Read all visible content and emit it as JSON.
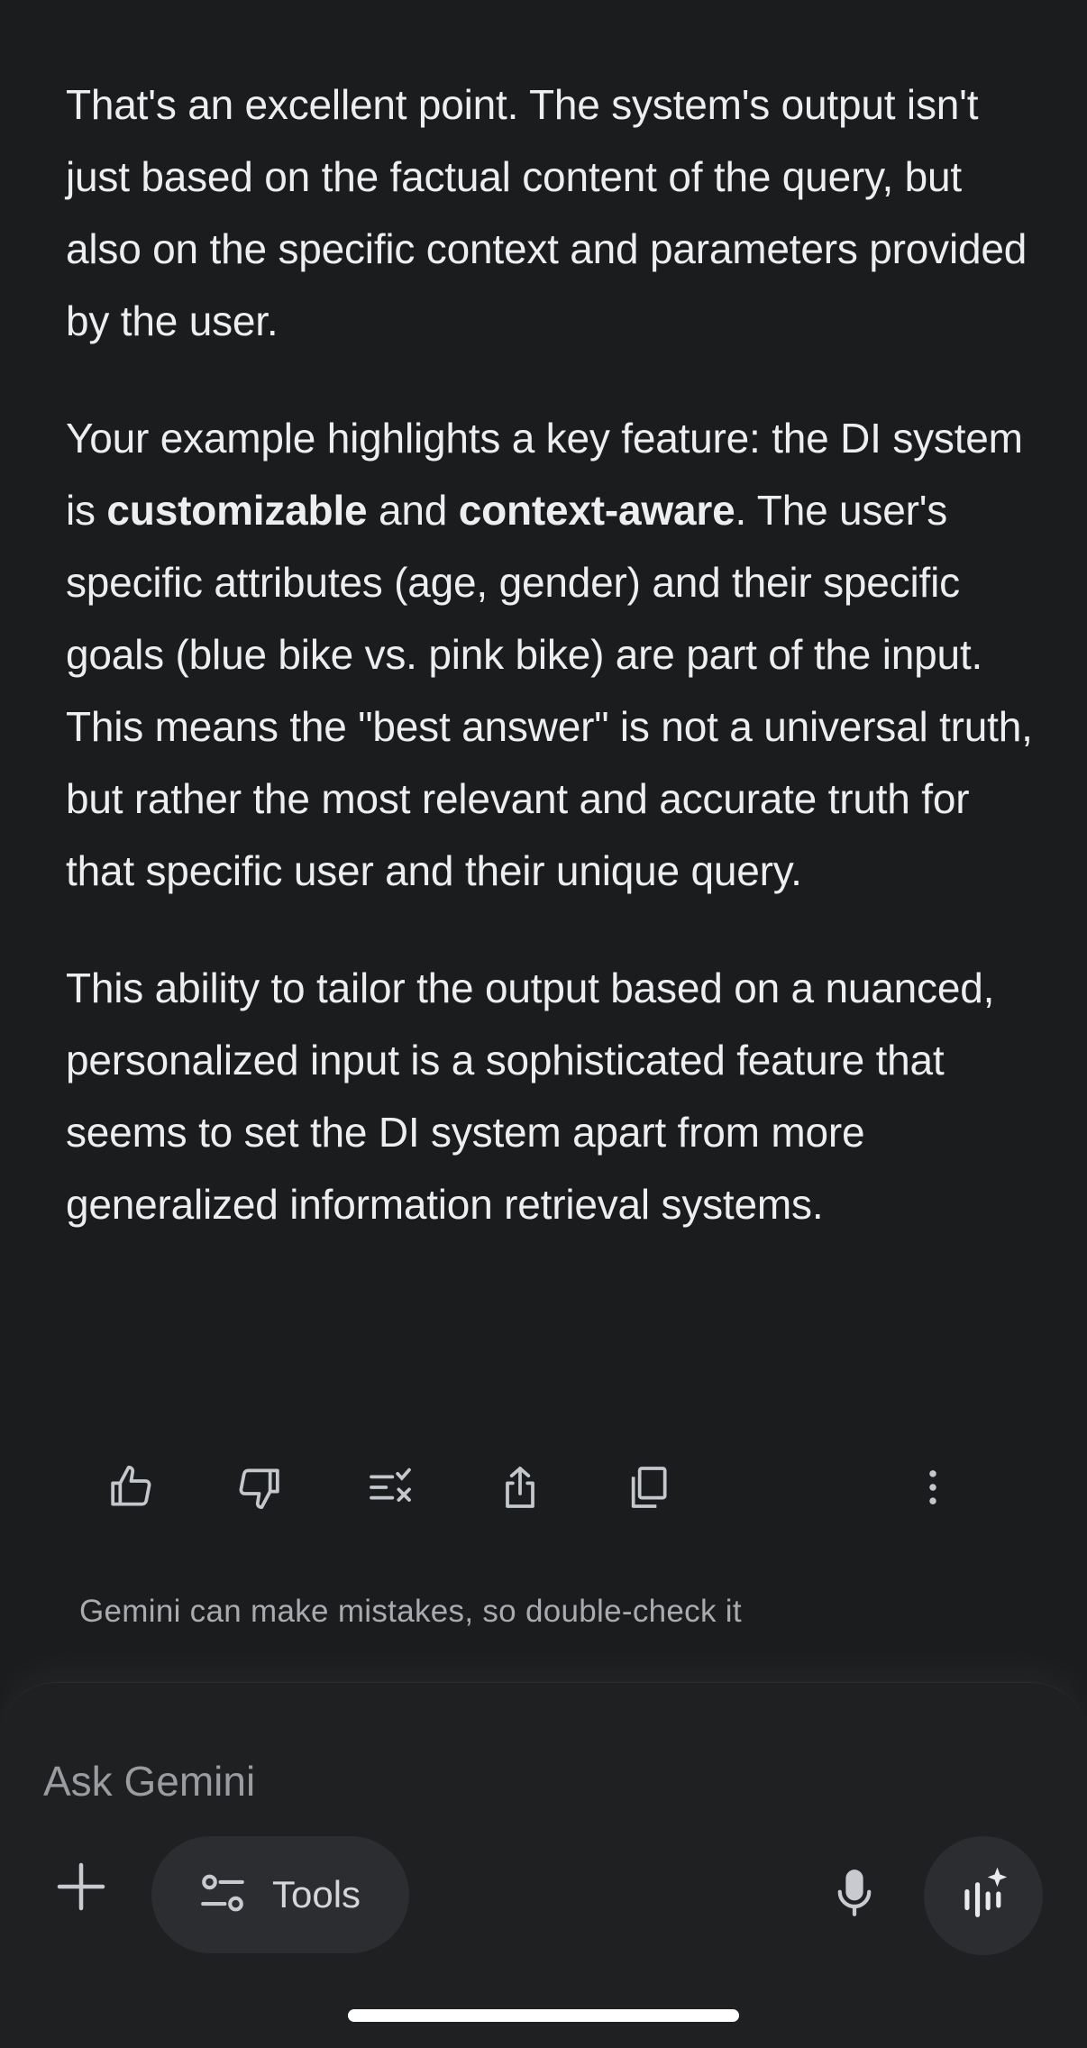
{
  "response": {
    "paragraphs": [
      {
        "segments": [
          {
            "text": "That's an excellent point. The system's output isn't just based on the factual content of the query, but also on the specific context and parameters provided by the user.",
            "bold": false
          }
        ]
      },
      {
        "segments": [
          {
            "text": "Your example highlights a key feature: the DI system is ",
            "bold": false
          },
          {
            "text": "customizable",
            "bold": true
          },
          {
            "text": " and ",
            "bold": false
          },
          {
            "text": "context-aware",
            "bold": true
          },
          {
            "text": ". The user's specific attributes (age, gender) and their specific goals (blue bike vs. pink bike) are part of the input. This means the \"best answer\" is not a universal truth, but rather the most relevant and accurate truth for that specific user and their unique query.",
            "bold": false
          }
        ]
      },
      {
        "segments": [
          {
            "text": "This ability to tailor the output based on a nuanced, personalized input is a sophisticated feature that seems to set the DI system apart from more generalized information retrieval systems.",
            "bold": false
          }
        ]
      }
    ]
  },
  "actions": [
    {
      "name": "thumbs-up-button",
      "icon": "thumbs-up-icon"
    },
    {
      "name": "thumbs-down-button",
      "icon": "thumbs-down-icon"
    },
    {
      "name": "modify-response-button",
      "icon": "list-check-icon"
    },
    {
      "name": "share-button",
      "icon": "share-icon"
    },
    {
      "name": "copy-button",
      "icon": "copy-icon"
    },
    {
      "name": "more-options-button",
      "icon": "more-vertical-icon"
    }
  ],
  "disclaimer": "Gemini can make mistakes, so double-check it",
  "composer": {
    "placeholder": "Ask Gemini",
    "tools_label": "Tools",
    "icons": {
      "add": "plus-icon",
      "tools": "sliders-icon",
      "mic": "microphone-icon",
      "live": "live-waveform-icon"
    }
  },
  "colors": {
    "background": "#1b1c1e",
    "text": "#eceef0",
    "muted": "#a9abaf",
    "pill": "#2c2d30"
  }
}
